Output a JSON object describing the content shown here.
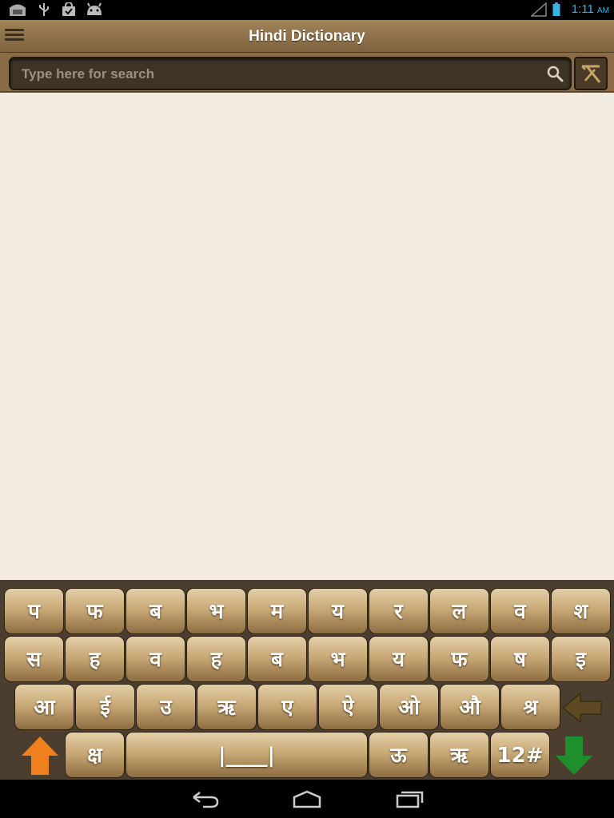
{
  "status_bar": {
    "time": "1:11",
    "ampm": "AM",
    "icons": [
      "phone-icon",
      "usb-icon",
      "bag-icon",
      "android-icon",
      "signal-icon",
      "battery-icon"
    ]
  },
  "app_bar": {
    "title": "Hindi Dictionary"
  },
  "search": {
    "placeholder": "Type here for search",
    "value": ""
  },
  "keyboard": {
    "row1": [
      "प",
      "फ",
      "ब",
      "भ",
      "म",
      "य",
      "र",
      "ल",
      "व",
      "श"
    ],
    "row2": [
      "स",
      "ह",
      "व",
      "ह",
      "ब",
      "भ",
      "य",
      "फ",
      "ष",
      "इ"
    ],
    "row3": [
      "आ",
      "ई",
      "उ",
      "ऋ",
      "ए",
      "ऐ",
      "ओ",
      "औ",
      "श्र"
    ],
    "row4": {
      "ksha": "क्ष",
      "space": "|____|",
      "uu": "ऊ",
      "rii": "ऋ",
      "numbers": "12#"
    },
    "colors": {
      "shift": "#f07f1e",
      "enter": "#1f8f2c",
      "backspace": "#5d4a22"
    }
  },
  "nav_bar": {
    "buttons": [
      "back-icon",
      "home-icon",
      "recent-apps-icon"
    ]
  }
}
